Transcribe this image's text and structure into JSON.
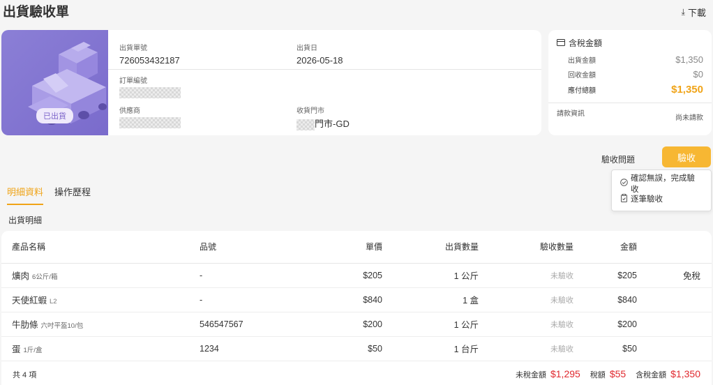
{
  "header": {
    "title": "出貨驗收單",
    "download_label": "下載"
  },
  "shipment": {
    "status": "已出貨",
    "shipment_no_label": "出貨單號",
    "shipment_no": "726053432187",
    "ship_date_label": "出貨日",
    "ship_date": "2026-05-18",
    "order_no_label": "訂單編號",
    "supplier_label": "供應商",
    "store_label": "收貨門市",
    "store_suffix": "門市-GD"
  },
  "amounts": {
    "title": "含稅金額",
    "ship_amount_label": "出貨金額",
    "ship_amount": "$1,350",
    "return_amount_label": "回收金額",
    "return_amount": "$0",
    "total_label": "應付總額",
    "total": "$1,350",
    "payment_label": "請款資訊",
    "payment_status": "尚未請款"
  },
  "actions": {
    "issue_label": "驗收問題",
    "accept_label": "驗收",
    "dropdown": [
      {
        "icon": "check-circle-icon",
        "label": "確認無誤，完成驗收"
      },
      {
        "icon": "clipboard-icon",
        "label": "逐筆驗收"
      }
    ]
  },
  "tabs": [
    {
      "label": "明細資料",
      "active": true
    },
    {
      "label": "操作歷程",
      "active": false
    }
  ],
  "section_title": "出貨明細",
  "table": {
    "headers": [
      "產品名稱",
      "品號",
      "單價",
      "出貨數量",
      "驗收數量",
      "金額"
    ],
    "rows": [
      {
        "name": "爌肉",
        "spec": "6公斤/箱",
        "code": "-",
        "price": "$205",
        "qty": "1 公斤",
        "accepted": "未驗收",
        "amount": "$205",
        "tax": "免稅"
      },
      {
        "name": "天使紅蝦",
        "spec": "L2",
        "code": "-",
        "price": "$840",
        "qty": "1 盒",
        "accepted": "未驗收",
        "amount": "$840",
        "tax": ""
      },
      {
        "name": "牛肋條",
        "spec": "六吋平盔10/包",
        "code": "546547567",
        "price": "$200",
        "qty": "1 公斤",
        "accepted": "未驗收",
        "amount": "$200",
        "tax": ""
      },
      {
        "name": "蛋",
        "spec": "1斤/盒",
        "code": "1234",
        "price": "$50",
        "qty": "1 台斤",
        "accepted": "未驗收",
        "amount": "$50",
        "tax": ""
      }
    ]
  },
  "footer": {
    "count": "共 4 項",
    "pretax_label": "未稅金額",
    "pretax": "$1,295",
    "tax_label": "稅額",
    "tax": "$55",
    "taxed_label": "含稅金額",
    "taxed": "$1,350"
  },
  "colors": {
    "accent": "#f7b733",
    "hero": "#8b7fd6",
    "red": "#e0282e"
  }
}
